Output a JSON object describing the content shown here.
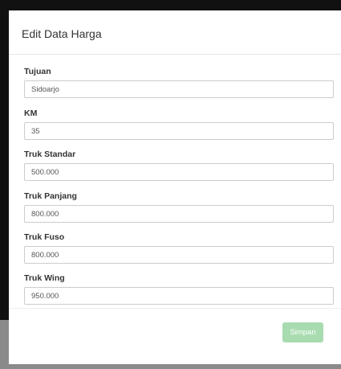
{
  "modal": {
    "title": "Edit Data Harga"
  },
  "form": {
    "fields": [
      {
        "label": "Tujuan",
        "value": "Sidoarjo"
      },
      {
        "label": "KM",
        "value": "35"
      },
      {
        "label": "Truk Standar",
        "value": "500.000"
      },
      {
        "label": "Truk Panjang",
        "value": "800.000"
      },
      {
        "label": "Truk Fuso",
        "value": "800.000"
      },
      {
        "label": "Truk Wing",
        "value": "950.000"
      }
    ]
  },
  "footer": {
    "save_label": "Simpan"
  },
  "colors": {
    "save_button": "#a8dcb0",
    "backdrop_dark": "#111111",
    "backdrop_grey": "#8a8a8a"
  }
}
